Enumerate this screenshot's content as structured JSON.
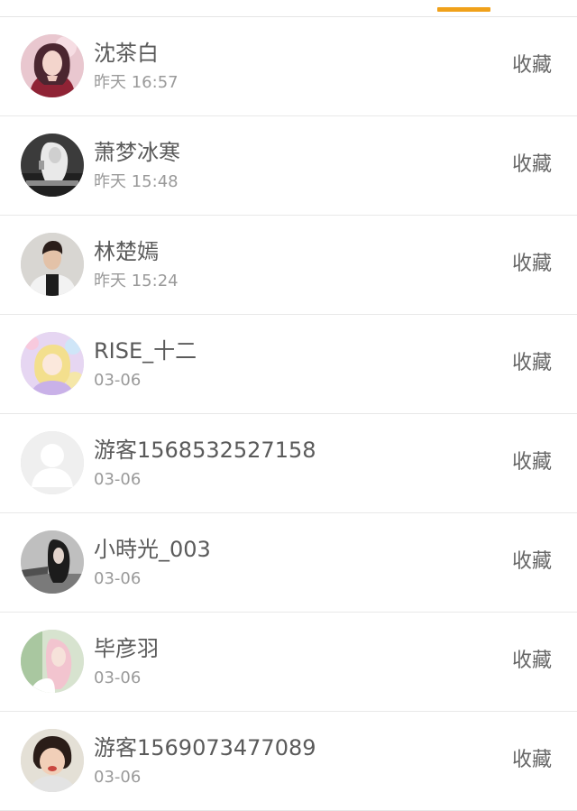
{
  "accent_color": "#f0a11a",
  "items": [
    {
      "name": "沈茶白",
      "time": "昨天 16:57",
      "action": "收藏",
      "avatar": "avatar-photo-woman-red"
    },
    {
      "name": "萧梦冰寒",
      "time": "昨天 15:48",
      "action": "收藏",
      "avatar": "avatar-photo-monochrome-figure"
    },
    {
      "name": "林楚嫣",
      "time": "昨天 15:24",
      "action": "收藏",
      "avatar": "avatar-photo-man-dark-jacket"
    },
    {
      "name": "RISE_十二",
      "time": "03-06",
      "action": "收藏",
      "avatar": "avatar-anime-pastel"
    },
    {
      "name": "游客1568532527158",
      "time": "03-06",
      "action": "收藏",
      "avatar": "default-user-icon"
    },
    {
      "name": "小時光_003",
      "time": "03-06",
      "action": "收藏",
      "avatar": "avatar-photo-dark-hair"
    },
    {
      "name": "毕彦羽",
      "time": "03-06",
      "action": "收藏",
      "avatar": "avatar-photo-pink-hair"
    },
    {
      "name": "游客1569073477089",
      "time": "03-06",
      "action": "收藏",
      "avatar": "avatar-photo-child"
    }
  ]
}
